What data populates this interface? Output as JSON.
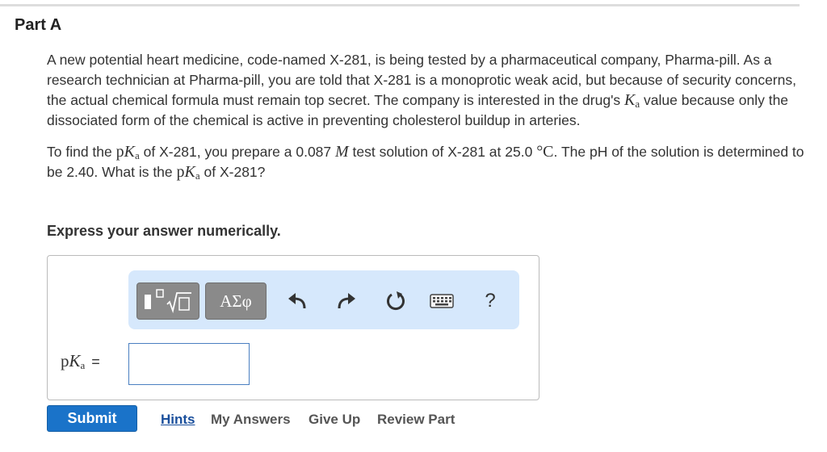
{
  "part": {
    "title": "Part A"
  },
  "problem": {
    "p1_a": "A new potential heart medicine, code-named X-281, is being tested by a pharmaceutical company, Pharma-pill. As a research technician at Pharma-pill, you are told that X-281 is a monoprotic weak acid, but because of security concerns, the actual chemical formula must remain top secret. The company is interested in the drug's ",
    "p1_ka_main": "K",
    "p1_ka_sub": "a",
    "p1_b": " value because only the dissociated form of the chemical is active in preventing cholesterol buildup in arteries.",
    "p2_a": "To find the ",
    "p2_pka_p": "p",
    "p2_pka_k": "K",
    "p2_pka_sub": "a",
    "p2_b": " of X-281, you prepare a 0.087 ",
    "p2_molar": "M",
    "p2_c": " test solution of X-281 at 25.0 ",
    "p2_temp_unit": "°C",
    "p2_d": ". The pH of the solution is determined to be 2.40. What is the ",
    "p2_pka2_p": "p",
    "p2_pka2_k": "K",
    "p2_pka2_sub": "a",
    "p2_e": " of X-281?",
    "instruction": "Express your answer numerically."
  },
  "toolbar": {
    "symbols_label": "ΑΣφ",
    "help_label": "?",
    "icons": [
      "templates-icon",
      "undo-icon",
      "redo-icon",
      "reset-icon",
      "keyboard-icon",
      "help-icon"
    ]
  },
  "answer": {
    "label_p": "p",
    "label_k": "K",
    "label_sub": "a",
    "label_eq": "=",
    "value": "",
    "placeholder": ""
  },
  "footer": {
    "submit_label": "Submit",
    "hints_label": "Hints",
    "my_answers_label": "My Answers",
    "give_up_label": "Give Up",
    "review_part_label": "Review Part"
  },
  "colors": {
    "accent": "#1a73c9",
    "toolbar_bg": "#d6e8fc",
    "link": "#1a4f9c",
    "input_border": "#4a7fc1"
  }
}
